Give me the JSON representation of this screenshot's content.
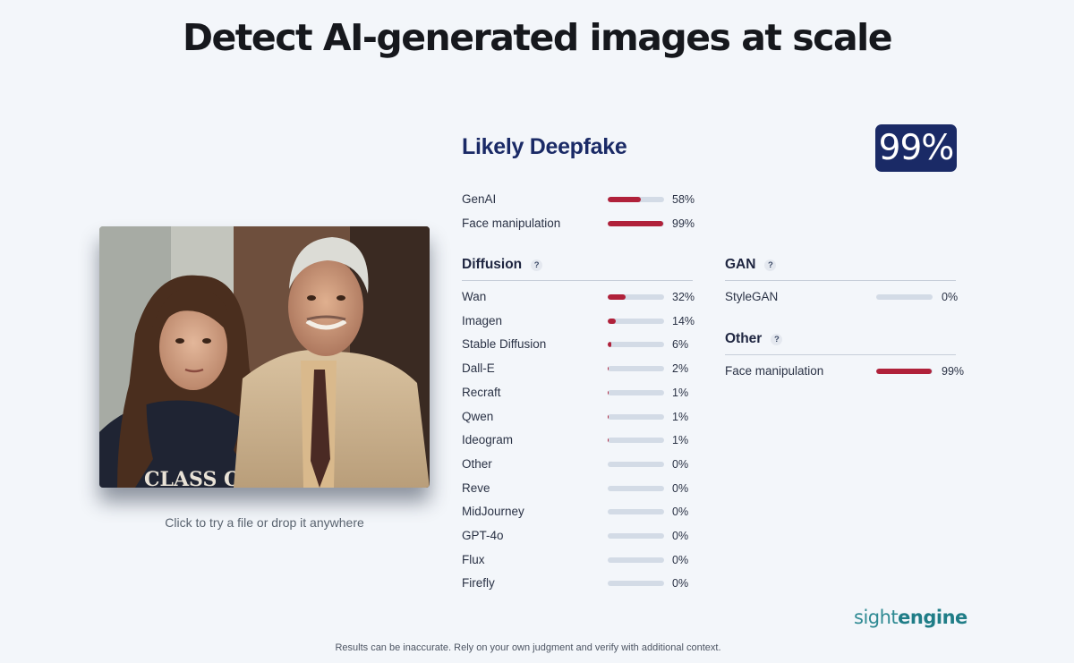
{
  "headline": "Detect AI-generated images at scale",
  "photo": {
    "caption_text": "CLASS OF",
    "hint": "Click to try a file or drop it anywhere"
  },
  "result": {
    "verdict": "Likely Deepfake",
    "score": "99%",
    "accent_color": "#b0213a",
    "badge_color": "#1a2a66"
  },
  "summary": [
    {
      "label": "GenAI",
      "value": 58,
      "text": "58%"
    },
    {
      "label": "Face manipulation",
      "value": 99,
      "text": "99%"
    }
  ],
  "diffusion": {
    "title": "Diffusion",
    "help": "?",
    "items": [
      {
        "label": "Wan",
        "value": 32,
        "text": "32%"
      },
      {
        "label": "Imagen",
        "value": 14,
        "text": "14%"
      },
      {
        "label": "Stable Diffusion",
        "value": 6,
        "text": "6%"
      },
      {
        "label": "Dall-E",
        "value": 2,
        "text": "2%"
      },
      {
        "label": "Recraft",
        "value": 1,
        "text": "1%"
      },
      {
        "label": "Qwen",
        "value": 1,
        "text": "1%"
      },
      {
        "label": "Ideogram",
        "value": 1,
        "text": "1%"
      },
      {
        "label": "Other",
        "value": 0,
        "text": "0%"
      },
      {
        "label": "Reve",
        "value": 0,
        "text": "0%"
      },
      {
        "label": "MidJourney",
        "value": 0,
        "text": "0%"
      },
      {
        "label": "GPT-4o",
        "value": 0,
        "text": "0%"
      },
      {
        "label": "Flux",
        "value": 0,
        "text": "0%"
      },
      {
        "label": "Firefly",
        "value": 0,
        "text": "0%"
      }
    ]
  },
  "gan": {
    "title": "GAN",
    "help": "?",
    "items": [
      {
        "label": "StyleGAN",
        "value": 0,
        "text": "0%"
      }
    ]
  },
  "other": {
    "title": "Other",
    "help": "?",
    "items": [
      {
        "label": "Face manipulation",
        "value": 99,
        "text": "99%"
      }
    ]
  },
  "brand": {
    "part1": "sight",
    "part2": "engine"
  },
  "disclaimer": "Results can be inaccurate. Rely on your own judgment and verify with additional context."
}
